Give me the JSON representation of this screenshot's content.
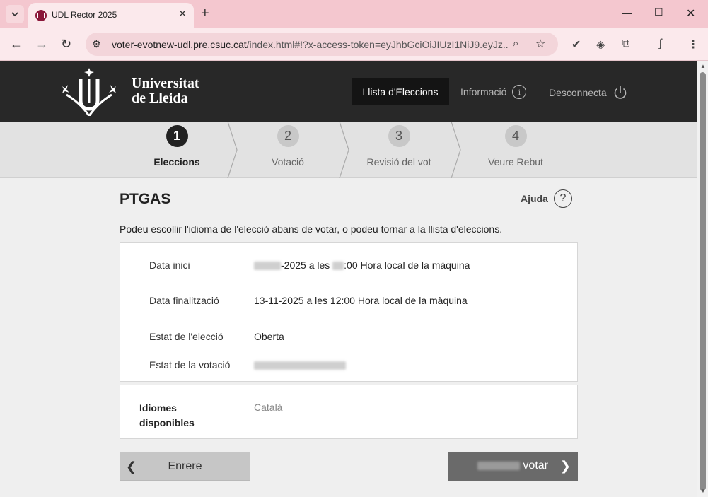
{
  "browser": {
    "tab_title": "UDL Rector 2025",
    "url_host": "voter-evotnew-udl.pre.csuc.cat",
    "url_rest": "/index.html#!?x-access-token=eyJhbGciOiJIUzI1NiJ9.eyJz..."
  },
  "header": {
    "logo_line1": "Universitat",
    "logo_line2": "de Lleida",
    "nav_active": "Llista d'Eleccions",
    "nav_info": "Informació",
    "nav_logout": "Desconnecta"
  },
  "steps": [
    {
      "num": "1",
      "label": "Eleccions"
    },
    {
      "num": "2",
      "label": "Votació"
    },
    {
      "num": "3",
      "label": "Revisió del vot"
    },
    {
      "num": "4",
      "label": "Veure Rebut"
    }
  ],
  "page": {
    "title": "PTGAS",
    "help": "Ajuda",
    "intro": "Podeu escollir l'idioma de l'elecció abans de votar, o podeu tornar a la llista d'eleccions."
  },
  "details": {
    "start_label": "Data inici",
    "start_value_mid": "-2025 a les ",
    "start_value_end": ":00 Hora local de la màquina",
    "end_label": "Data finalització",
    "end_value": "13-11-2025 a les 12:00 Hora local de la màquina",
    "state_label": "Estat de l'elecció",
    "state_value": "Oberta",
    "vote_state_label": "Estat de la votació"
  },
  "languages": {
    "label_line1": "Idiomes",
    "label_line2": "disponibles",
    "value": "Català"
  },
  "buttons": {
    "back": "Enrere",
    "vote": "votar"
  }
}
